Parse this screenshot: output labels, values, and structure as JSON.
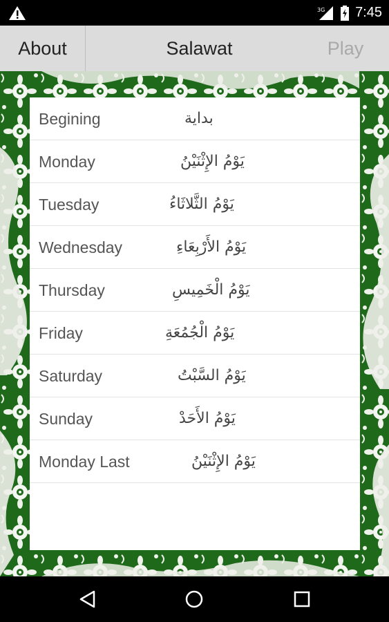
{
  "status_bar": {
    "time": "7:45",
    "network_label": "3G"
  },
  "action_bar": {
    "about_label": "About",
    "title": "Salawat",
    "play_label": "Play"
  },
  "days": [
    {
      "en": "Begining",
      "ar": "بداية"
    },
    {
      "en": "Monday",
      "ar": "يَوْمُ الإِثْنَيْنُ"
    },
    {
      "en": "Tuesday",
      "ar": "يَوْمُ الثَّلاثَاءُ"
    },
    {
      "en": "Wednesday",
      "ar": "يَوْمُ الأَرْبِعَاءِ"
    },
    {
      "en": "Thursday",
      "ar": "يَوْمُ الْخَمِيسِ"
    },
    {
      "en": "Friday",
      "ar": "يَوْمُ الْجُمُعَةِ"
    },
    {
      "en": "Saturday",
      "ar": "يَوْمُ السَّبْتُ"
    },
    {
      "en": "Sunday",
      "ar": "يَوْمُ الأَحَدْ"
    },
    {
      "en": "Monday Last",
      "ar": "يَوْمُ الإِثْنَيْنُ"
    }
  ],
  "colors": {
    "pattern_green": "#1f6a1a",
    "action_bar_bg": "#dcdcdc",
    "play_disabled": "#a9a9a9"
  },
  "icons": [
    "warning-icon",
    "signal-icon",
    "battery-icon",
    "back-icon",
    "home-icon",
    "recents-icon"
  ]
}
